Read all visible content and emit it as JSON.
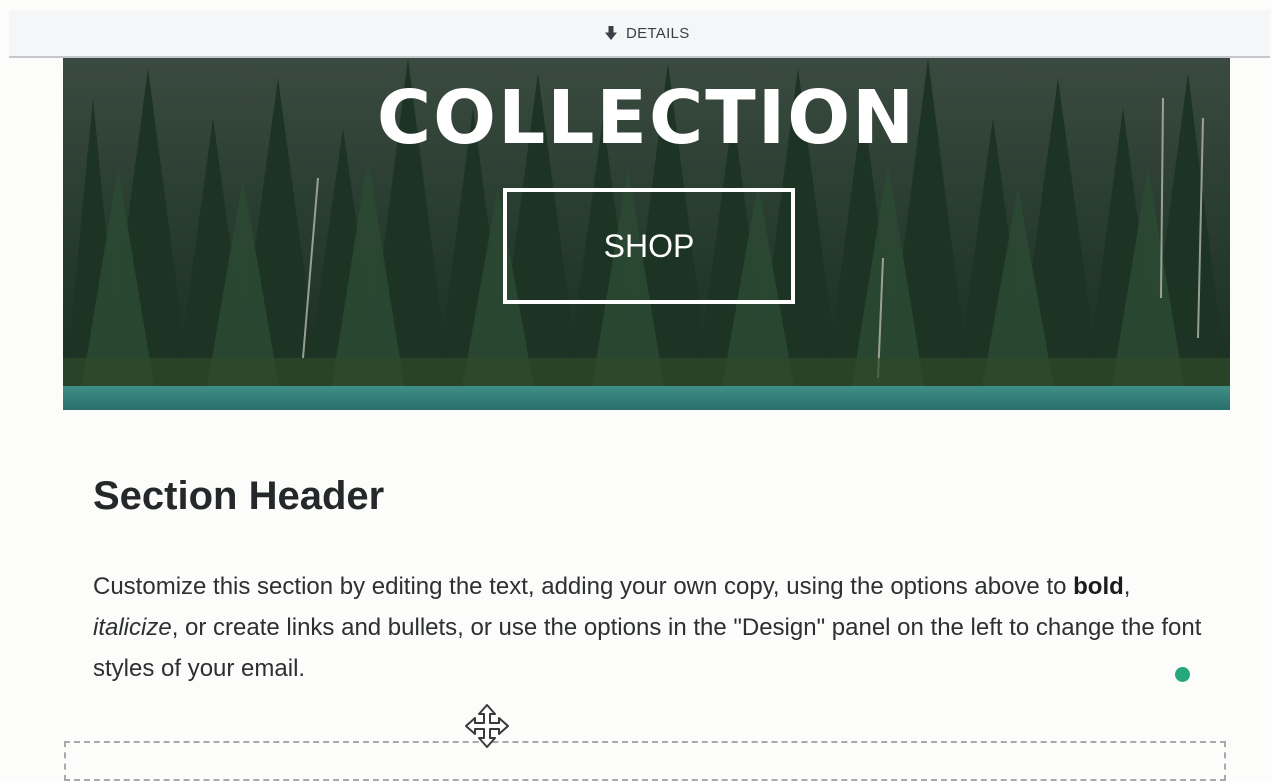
{
  "toolbar": {
    "details_label": "DETAILS",
    "details_icon": "arrow-down-icon"
  },
  "hero": {
    "title": "COLLECTION",
    "button_label": "SHOP",
    "image_description": "forest-lake-photo"
  },
  "section": {
    "header": "Section Header",
    "body_parts": {
      "p1": "Customize this section by editing the text, adding your own copy, using the options above to ",
      "bold": "bold",
      "p2": ", ",
      "italic": "italicize",
      "p3": ", or create links and bullets, or use the options in the \"Design\" panel on the left to change the font styles of your email."
    }
  },
  "colors": {
    "status_dot": "#26a87d",
    "text_dark": "#25282b",
    "toolbar_bg": "#f5f6f8"
  },
  "icons": {
    "move": "move-arrows-icon"
  }
}
